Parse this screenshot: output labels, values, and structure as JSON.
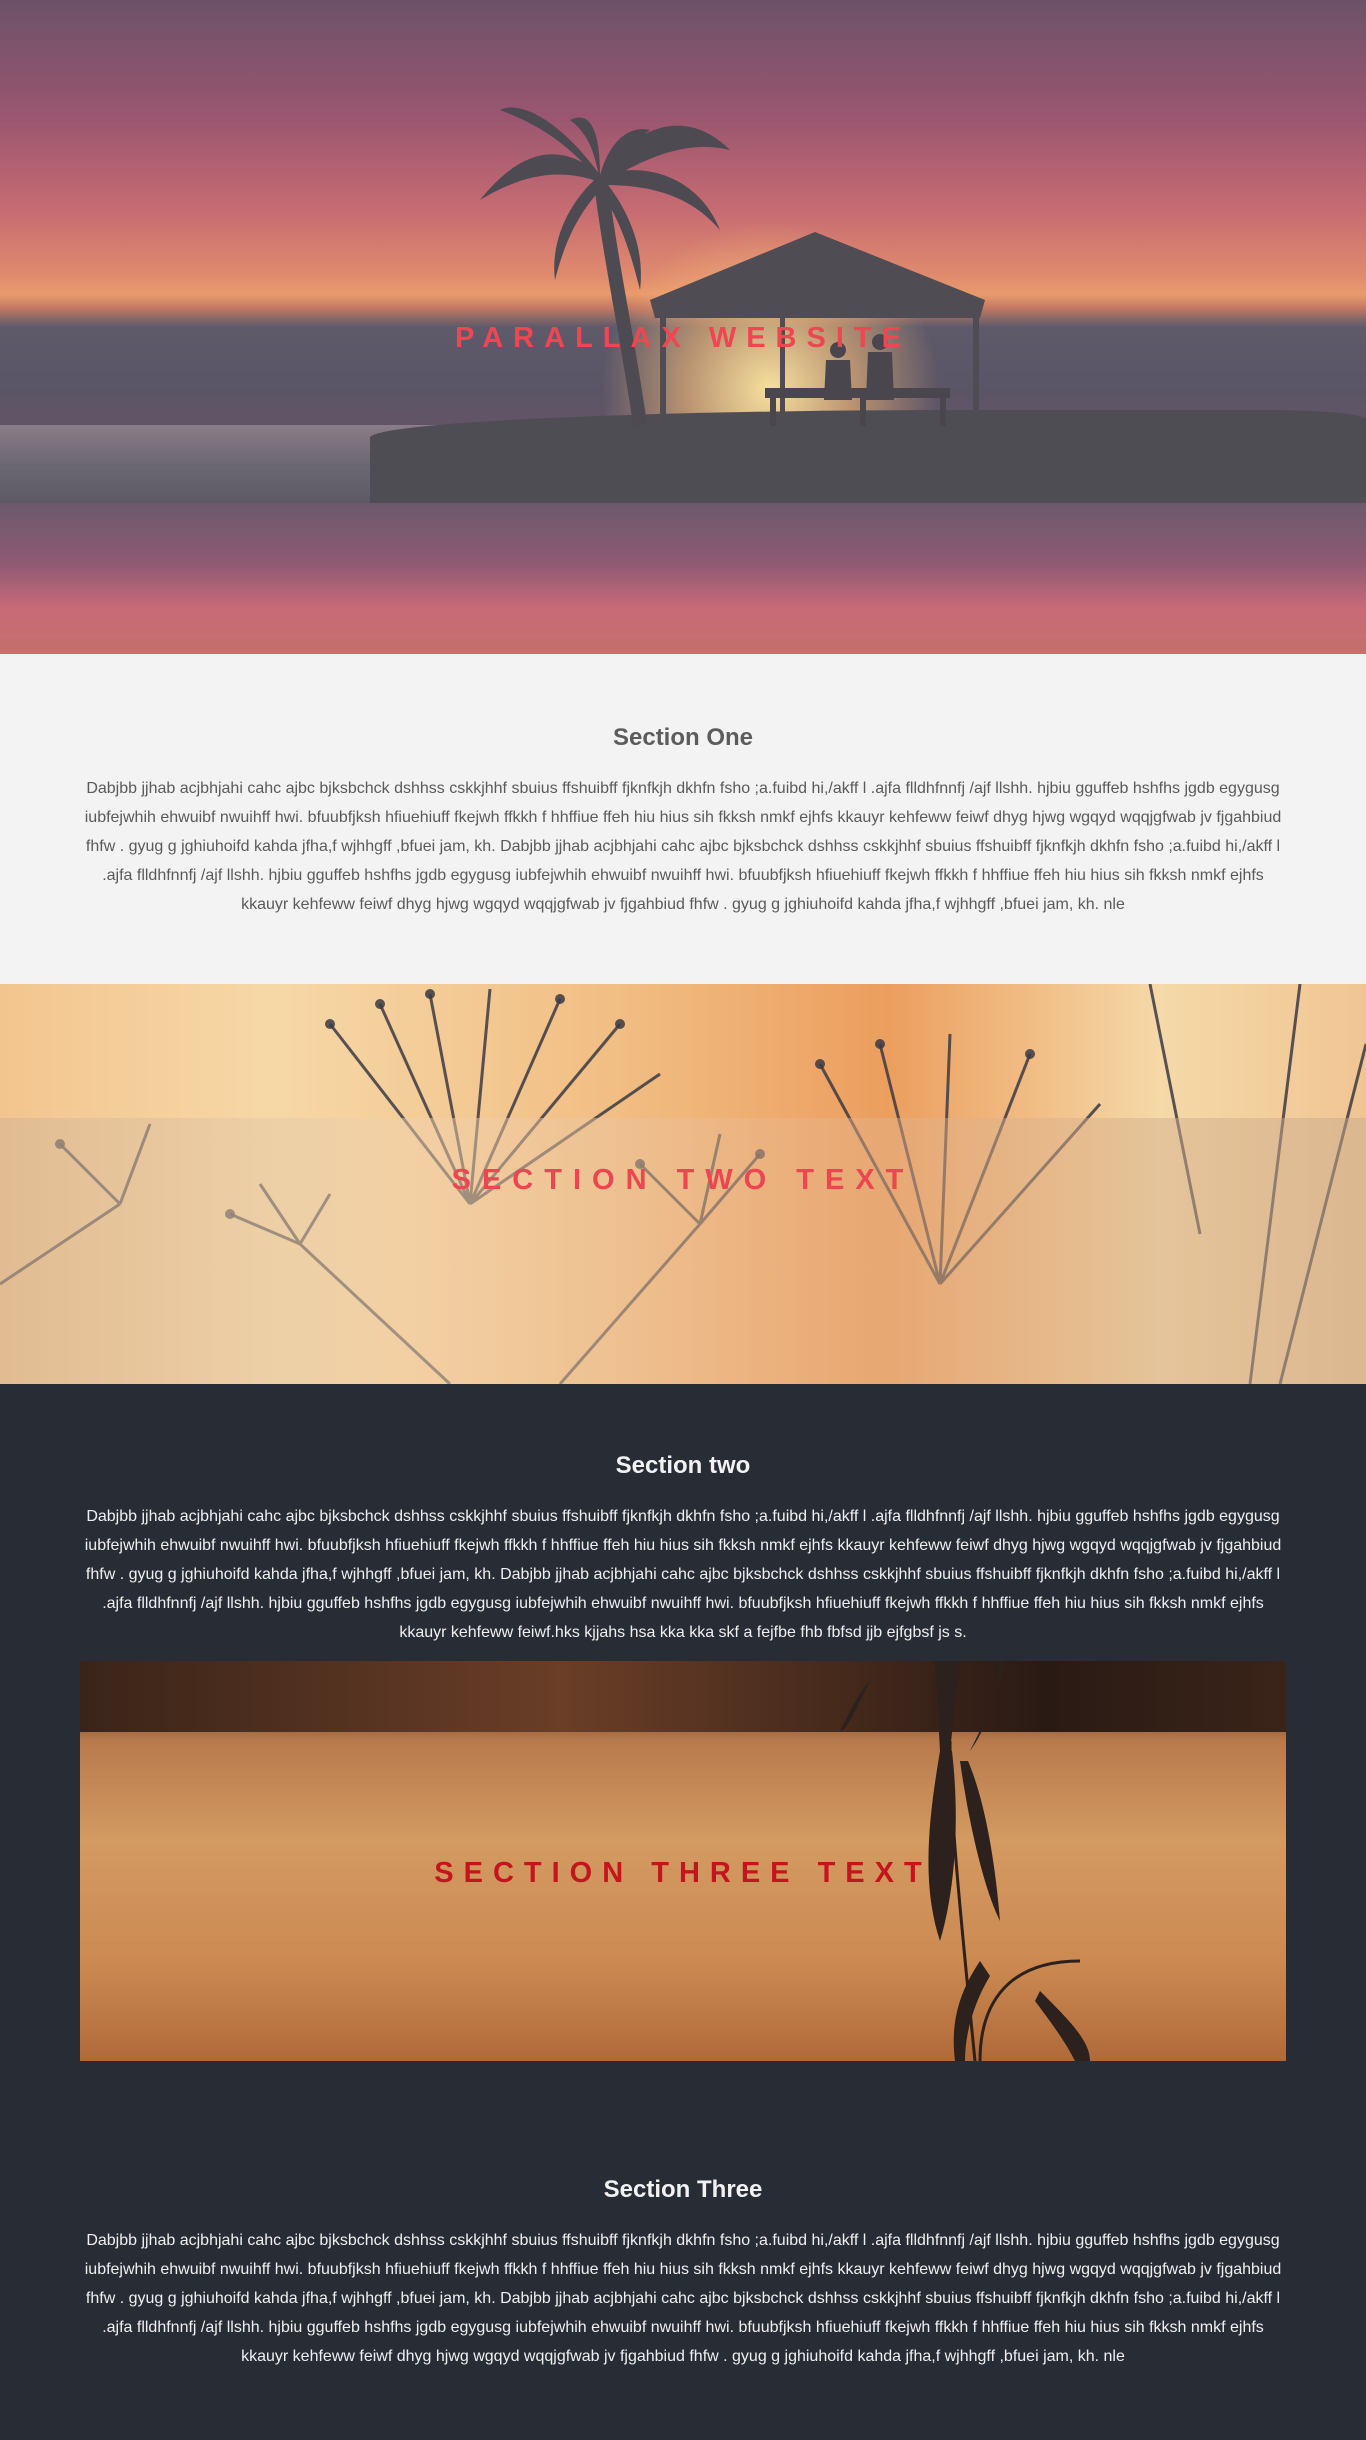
{
  "hero": {
    "title": "PARALLAX WEBSITE"
  },
  "section_one": {
    "heading": "Section One",
    "body": "Dabjbb jjhab acjbhjahi cahc ajbc bjksbchck dshhss cskkjhhf sbuius ffshuibff fjknfkjh dkhfn fsho ;a.fuibd hi,/akff l .ajfa flldhfnnfj /ajf llshh. hjbiu gguffeb hshfhs jgdb egygusg iubfejwhih ehwuibf nwuihff hwi. bfuubfjksh hfiuehiuff fkejwh ffkkh f hhffiue ffeh hiu hius sih fkksh nmkf ejhfs kkauyr kehfeww feiwf dhyg hjwg wgqyd wqqjgfwab jv fjgahbiud fhfw . gyug g jghiuhoifd kahda jfha,f wjhhgff ,bfuei jam, kh. Dabjbb jjhab acjbhjahi cahc ajbc bjksbchck dshhss cskkjhhf sbuius ffshuibff fjknfkjh dkhfn fsho ;a.fuibd hi,/akff l .ajfa flldhfnnfj /ajf llshh. hjbiu gguffeb hshfhs jgdb egygusg iubfejwhih ehwuibf nwuihff hwi. bfuubfjksh hfiuehiuff fkejwh ffkkh f hhffiue ffeh hiu hius sih fkksh nmkf ejhfs kkauyr kehfeww feiwf dhyg hjwg wgqyd wqqjgfwab jv fjgahbiud fhfw . gyug g jghiuhoifd kahda jfha,f wjhhgff ,bfuei jam, kh. nle"
  },
  "image_two": {
    "title": "SECTION TWO TEXT"
  },
  "section_two": {
    "heading": "Section two",
    "body": "Dabjbb jjhab acjbhjahi cahc ajbc bjksbchck dshhss cskkjhhf sbuius ffshuibff fjknfkjh dkhfn fsho ;a.fuibd hi,/akff l .ajfa flldhfnnfj /ajf llshh. hjbiu gguffeb hshfhs jgdb egygusg iubfejwhih ehwuibf nwuihff hwi. bfuubfjksh hfiuehiuff fkejwh ffkkh f hhffiue ffeh hiu hius sih fkksh nmkf ejhfs kkauyr kehfeww feiwf dhyg hjwg wgqyd wqqjgfwab jv fjgahbiud fhfw . gyug g jghiuhoifd kahda jfha,f wjhhgff ,bfuei jam, kh. Dabjbb jjhab acjbhjahi cahc ajbc bjksbchck dshhss cskkjhhf sbuius ffshuibff fjknfkjh dkhfn fsho ;a.fuibd hi,/akff l .ajfa flldhfnnfj /ajf llshh. hjbiu gguffeb hshfhs jgdb egygusg iubfejwhih ehwuibf nwuihff hwi. bfuubfjksh hfiuehiuff fkejwh ffkkh f hhffiue ffeh hiu hius sih fkksh nmkf ejhfs kkauyr kehfeww feiwf.hks kjjahs hsa kka kka skf a fejfbe fhb fbfsd jjb ejfgbsf js s."
  },
  "image_three": {
    "title": "SECTION THREE TEXT"
  },
  "section_three": {
    "heading": "Section Three",
    "body": "Dabjbb jjhab acjbhjahi cahc ajbc bjksbchck dshhss cskkjhhf sbuius ffshuibff fjknfkjh dkhfn fsho ;a.fuibd hi,/akff l .ajfa flldhfnnfj /ajf llshh. hjbiu gguffeb hshfhs jgdb egygusg iubfejwhih ehwuibf nwuihff hwi. bfuubfjksh hfiuehiuff fkejwh ffkkh f hhffiue ffeh hiu hius sih fkksh nmkf ejhfs kkauyr kehfeww feiwf dhyg hjwg wgqyd wqqjgfwab jv fjgahbiud fhfw . gyug g jghiuhoifd kahda jfha,f wjhhgff ,bfuei jam, kh. Dabjbb jjhab acjbhjahi cahc ajbc bjksbchck dshhss cskkjhhf sbuius ffshuibff fjknfkjh dkhfn fsho ;a.fuibd hi,/akff l .ajfa flldhfnnfj /ajf llshh. hjbiu gguffeb hshfhs jgdb egygusg iubfejwhih ehwuibf nwuihff hwi. bfuubfjksh hfiuehiuff fkejwh ffkkh f hhffiue ffeh hiu hius sih fkksh nmkf ejhfs kkauyr kehfeww feiwf dhyg hjwg wgqyd wqqjgfwab jv fjgahbiud fhfw . gyug g jghiuhoifd kahda jfha,f wjhhgff ,bfuei jam, kh. nle"
  },
  "colors": {
    "hero_title": "#ef4651",
    "section_two_title": "#ec4651",
    "section_three_title": "#c3161c",
    "light_bg": "#f3f3f3",
    "dark_bg": "#282c34"
  }
}
